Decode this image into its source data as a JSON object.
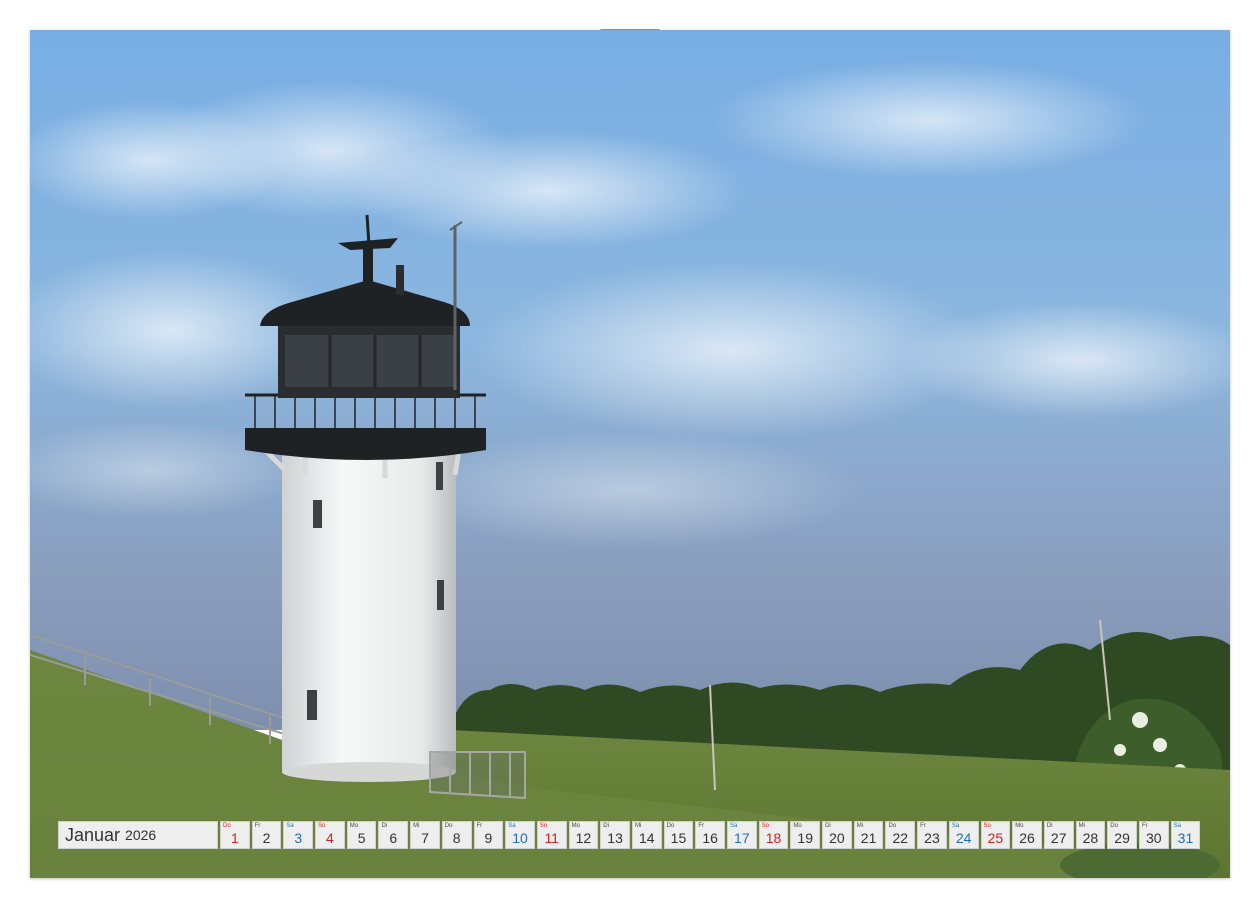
{
  "calendar": {
    "month": "Januar",
    "year": "2026",
    "days": [
      {
        "wd": "Do",
        "n": "1",
        "type": "holiday"
      },
      {
        "wd": "Fr",
        "n": "2",
        "type": "weekday"
      },
      {
        "wd": "Sa",
        "n": "3",
        "type": "sat"
      },
      {
        "wd": "So",
        "n": "4",
        "type": "sun"
      },
      {
        "wd": "Mo",
        "n": "5",
        "type": "weekday"
      },
      {
        "wd": "Di",
        "n": "6",
        "type": "weekday"
      },
      {
        "wd": "Mi",
        "n": "7",
        "type": "weekday"
      },
      {
        "wd": "Do",
        "n": "8",
        "type": "weekday"
      },
      {
        "wd": "Fr",
        "n": "9",
        "type": "weekday"
      },
      {
        "wd": "Sa",
        "n": "10",
        "type": "sat"
      },
      {
        "wd": "So",
        "n": "11",
        "type": "sun"
      },
      {
        "wd": "Mo",
        "n": "12",
        "type": "weekday"
      },
      {
        "wd": "Di",
        "n": "13",
        "type": "weekday"
      },
      {
        "wd": "Mi",
        "n": "14",
        "type": "weekday"
      },
      {
        "wd": "Do",
        "n": "15",
        "type": "weekday"
      },
      {
        "wd": "Fr",
        "n": "16",
        "type": "weekday"
      },
      {
        "wd": "Sa",
        "n": "17",
        "type": "sat"
      },
      {
        "wd": "So",
        "n": "18",
        "type": "sun"
      },
      {
        "wd": "Mo",
        "n": "19",
        "type": "weekday"
      },
      {
        "wd": "Di",
        "n": "20",
        "type": "weekday"
      },
      {
        "wd": "Mi",
        "n": "21",
        "type": "weekday"
      },
      {
        "wd": "Do",
        "n": "22",
        "type": "weekday"
      },
      {
        "wd": "Fr",
        "n": "23",
        "type": "weekday"
      },
      {
        "wd": "Sa",
        "n": "24",
        "type": "sat"
      },
      {
        "wd": "So",
        "n": "25",
        "type": "sun"
      },
      {
        "wd": "Mo",
        "n": "26",
        "type": "weekday"
      },
      {
        "wd": "Di",
        "n": "27",
        "type": "weekday"
      },
      {
        "wd": "Mi",
        "n": "28",
        "type": "weekday"
      },
      {
        "wd": "Do",
        "n": "29",
        "type": "weekday"
      },
      {
        "wd": "Fr",
        "n": "30",
        "type": "weekday"
      },
      {
        "wd": "Sa",
        "n": "31",
        "type": "sat"
      }
    ]
  },
  "colors": {
    "sky_top": "#7fb0e0",
    "sky_bottom": "#8a9fbd",
    "grass": "#6f8a3f",
    "tower": "#f2f3f2",
    "lantern": "#2a2d30",
    "saturday": "#1f6fb4",
    "sunday": "#d42020"
  }
}
